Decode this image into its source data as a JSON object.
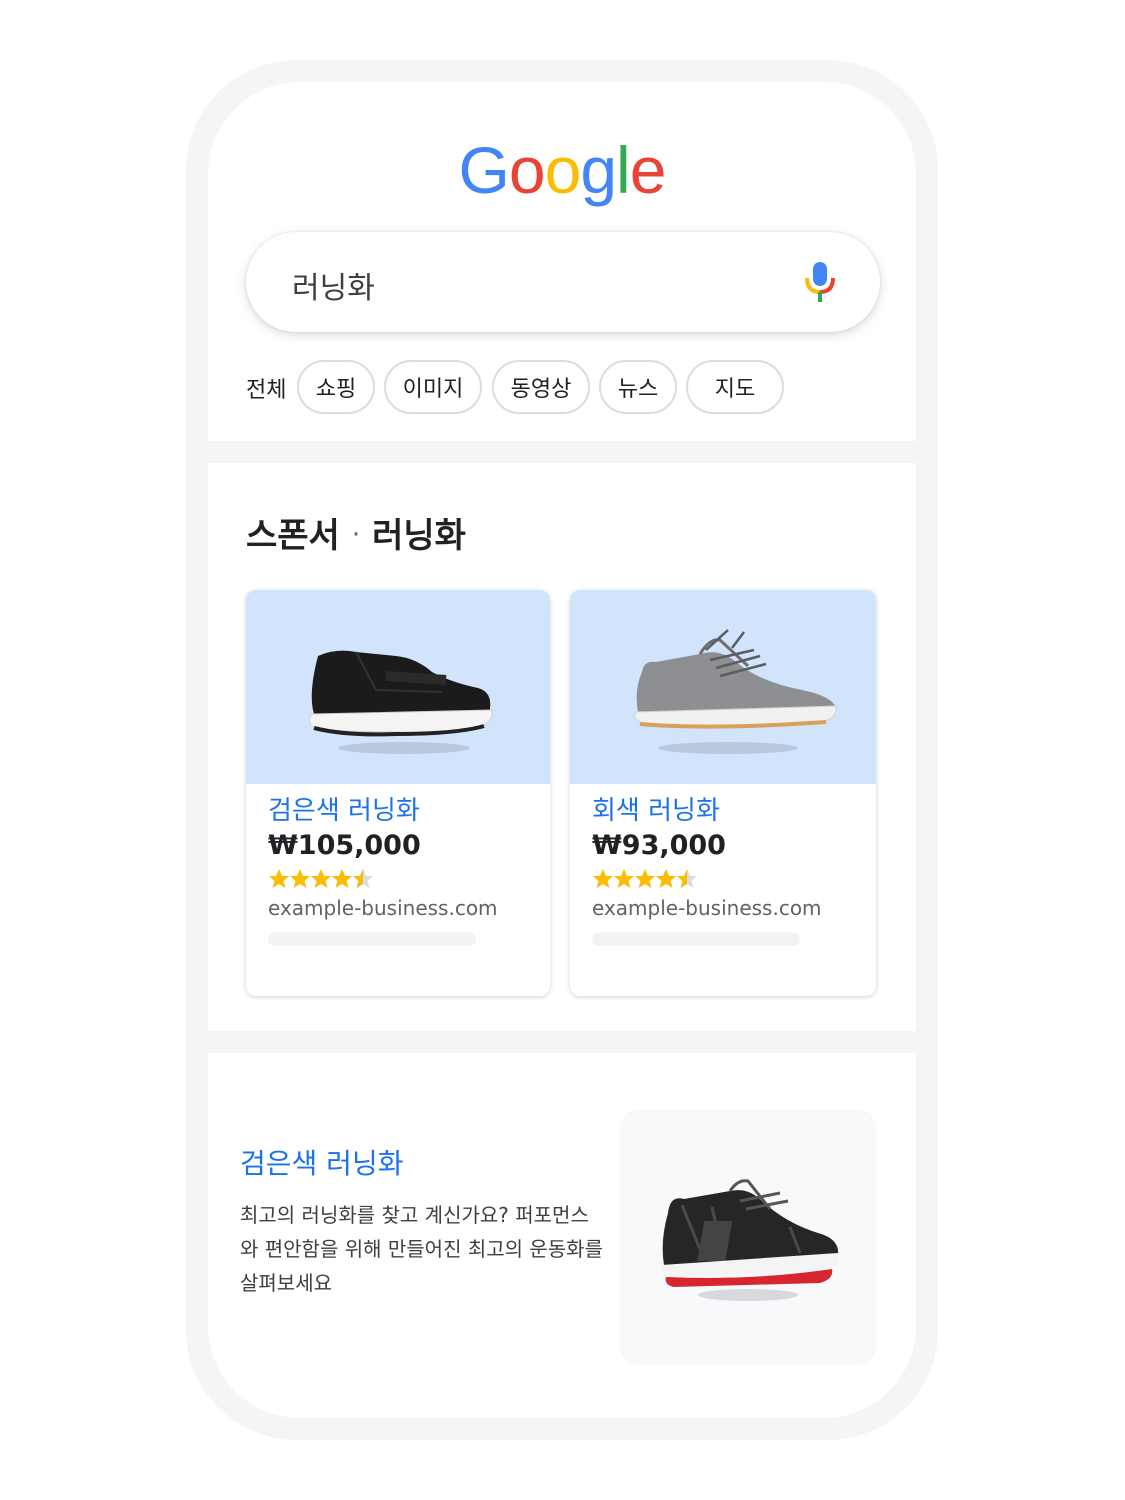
{
  "logo": {
    "letters": [
      "G",
      "o",
      "o",
      "g",
      "l",
      "e"
    ],
    "colors": [
      "#4285F4",
      "#EA4335",
      "#FBBC05",
      "#4285F4",
      "#34A853",
      "#EA4335"
    ]
  },
  "search": {
    "query": "러닝화",
    "mic_icon": "microphone-icon"
  },
  "tabs": {
    "all_label": "전체",
    "chips": [
      "쇼핑",
      "이미지",
      "동영상",
      "뉴스",
      "지도"
    ]
  },
  "sponsored": {
    "label": "스폰서",
    "separator": "·",
    "query": "러닝화",
    "products": [
      {
        "name": "검은색 러닝화",
        "price": "₩105,000",
        "rating": 4.5,
        "domain": "example-business.com",
        "image_icon": "black-slip-on-sneaker-image"
      },
      {
        "name": "회색 러닝화",
        "price": "₩93,000",
        "rating": 4.5,
        "domain": "example-business.com",
        "image_icon": "gray-lace-up-sneaker-image"
      }
    ]
  },
  "organic": {
    "title": "검은색 러닝화",
    "description": "최고의 러닝화를 찾고 계신가요? 퍼포먼스와 편안함을 위해 만들어진 최고의 운동화를 살펴보세요",
    "image_icon": "black-red-running-shoe-image"
  },
  "colors": {
    "link_blue": "#1a73e8",
    "star_yellow": "#fbbc04",
    "card_image_bg": "#d2e3fc",
    "divider_gray": "#f3f5f7"
  }
}
